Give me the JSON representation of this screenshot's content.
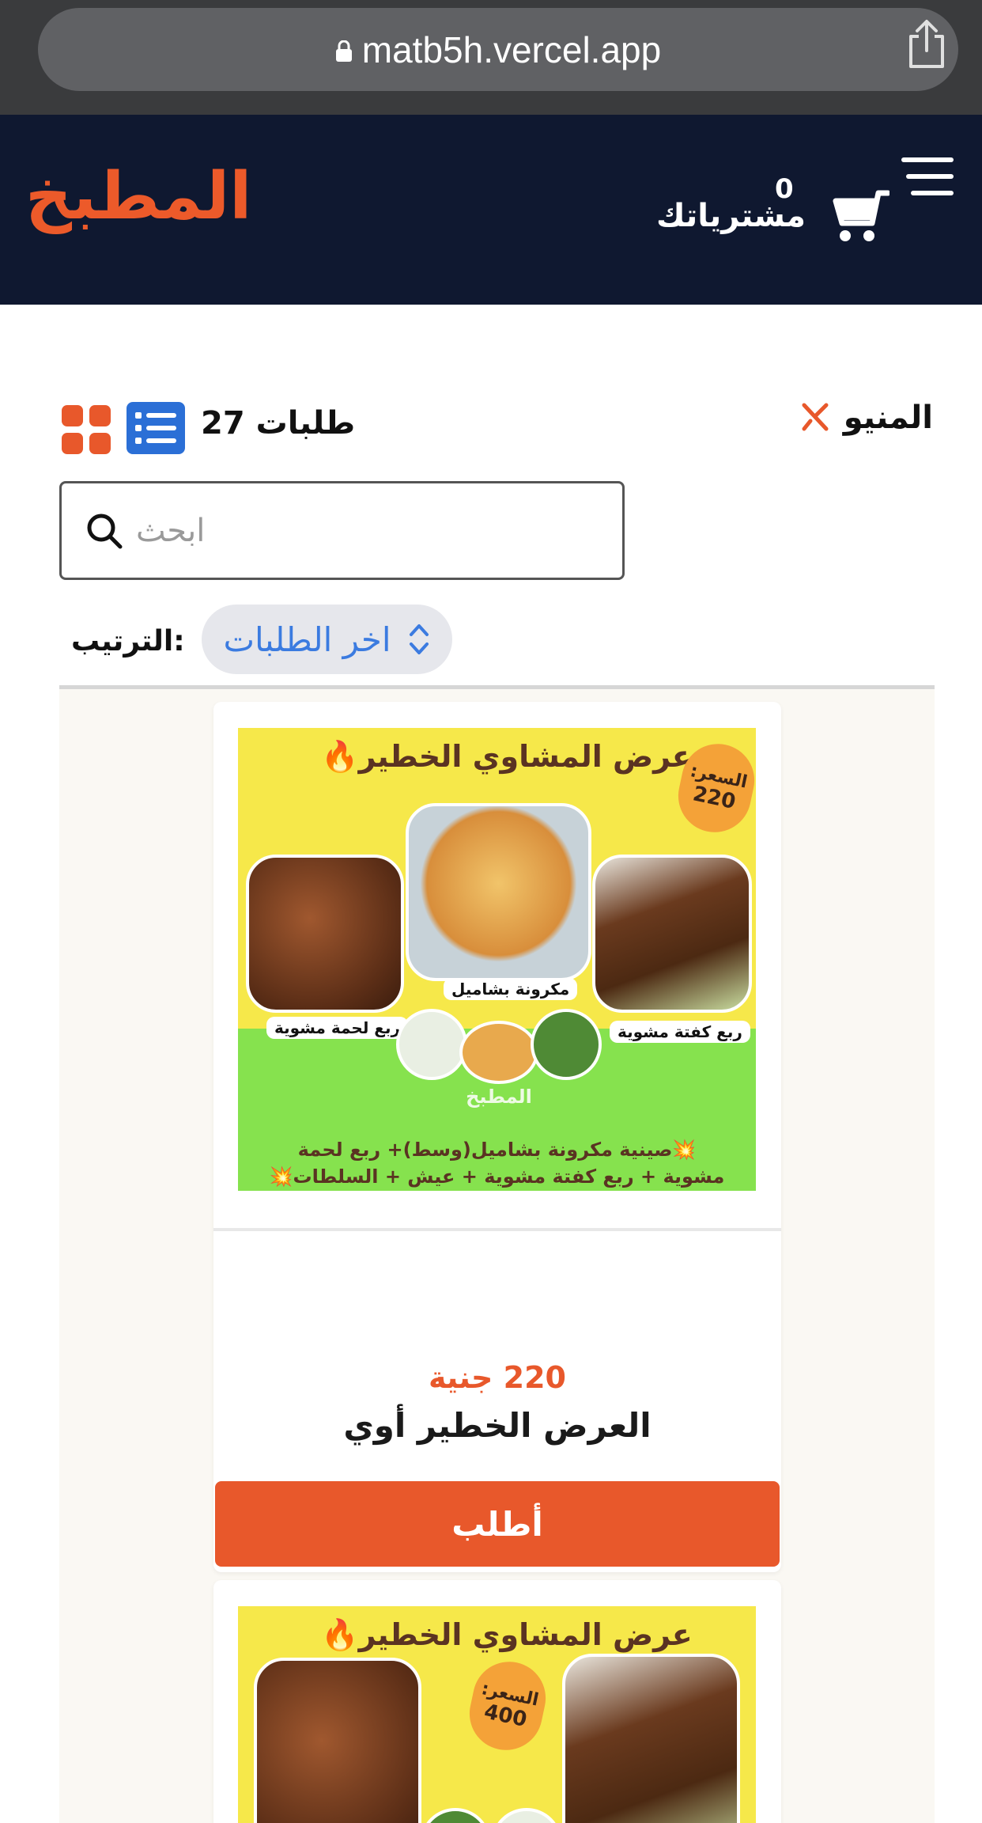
{
  "browser": {
    "url": "matb5h.vercel.app"
  },
  "header": {
    "logo": "المطبخ",
    "cart_label": "مشترياتك",
    "cart_count": "0"
  },
  "toolbar": {
    "menu_title": "المنيو",
    "orders_count_label": "طلبات 27",
    "search_placeholder": "ابحث",
    "search_value": "",
    "sort_label": ":الترتيب",
    "sort_value": "اخر الطلبات"
  },
  "colors": {
    "accent": "#e8582b",
    "header_bg": "#0f1830",
    "list_view_active": "#2b6fd6"
  },
  "products": [
    {
      "image": {
        "headline": "عرض المشاوي الخطير🔥",
        "badge_label": "السعر:",
        "badge_value": "220",
        "label_left": "ربع لحمة مشوية",
        "label_center": "مكرونة بشاميل",
        "label_right": "ربع كفتة مشوية",
        "brand": "المطبخ",
        "description_line1": "💥صينية مكرونة بشاميل(وسط)+ ربع لحمة",
        "description_line2": "مشوية + ربع كفتة مشوية + عيش + السلطات💥"
      },
      "price": "220 جنية",
      "title": "العرض الخطير أوي",
      "order_label": "أطلب"
    },
    {
      "image": {
        "headline": "عرض المشاوي الخطير🔥",
        "badge_label": "السعر:",
        "badge_value": "400"
      }
    }
  ]
}
